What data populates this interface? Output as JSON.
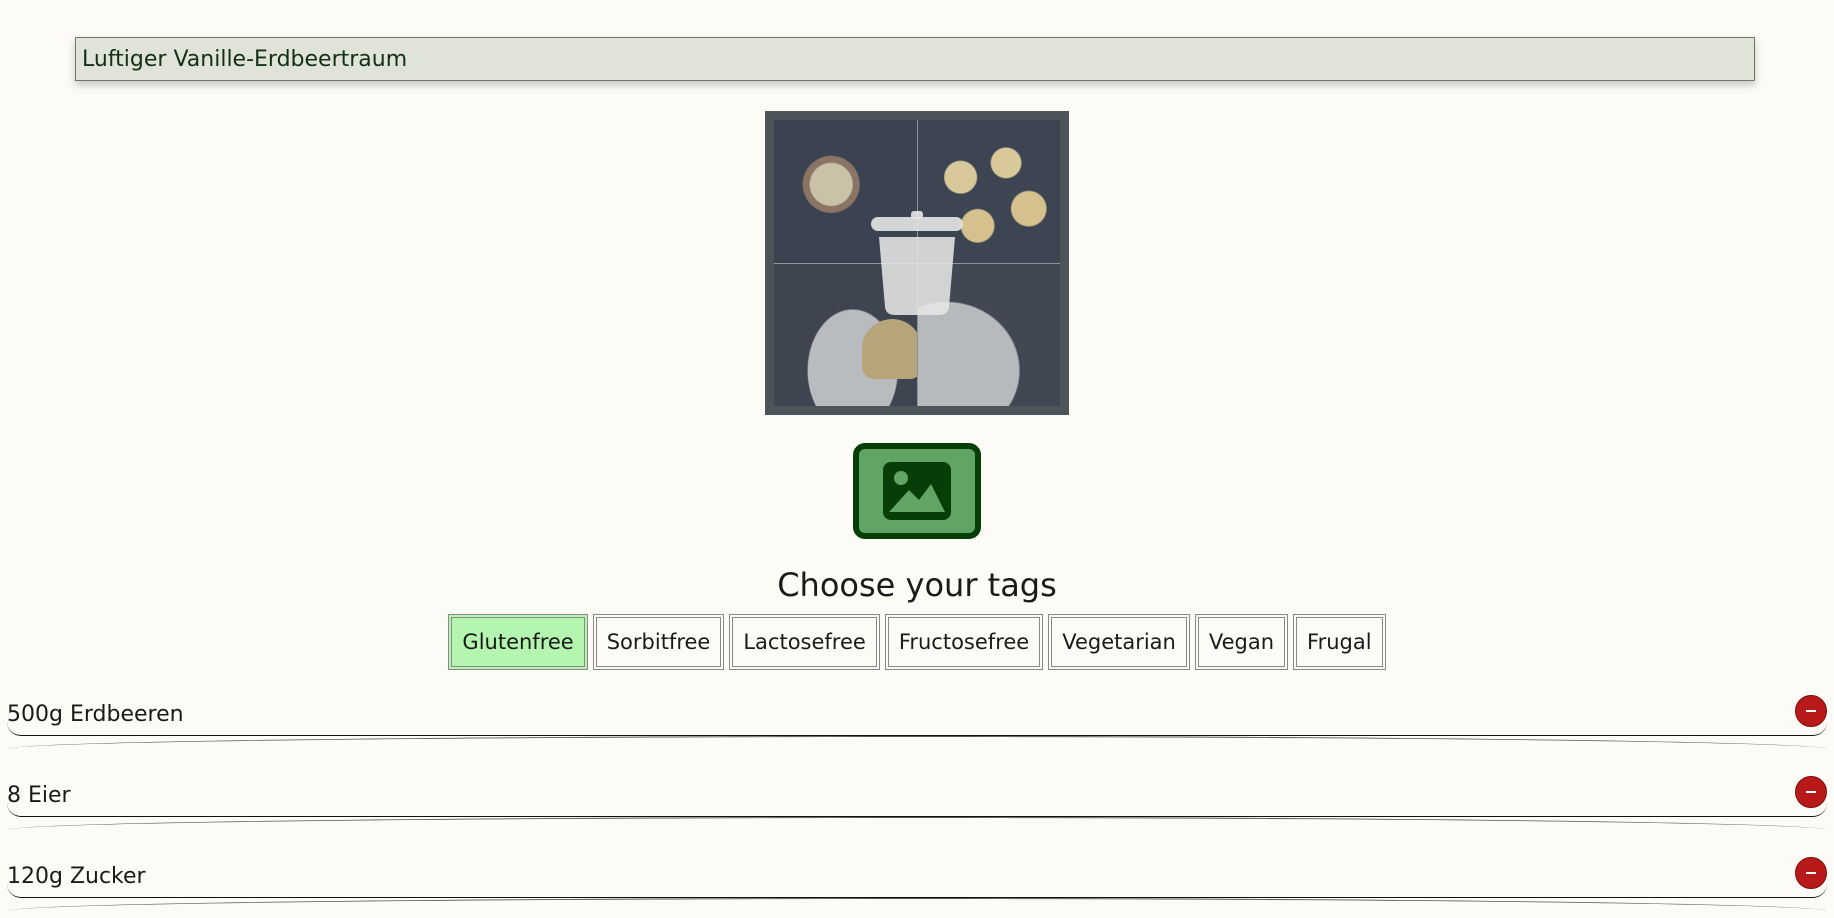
{
  "recipe": {
    "title": "Luftiger Vanille-Erdbeertraum"
  },
  "photo": {
    "overlay_icon": "trash-icon",
    "add_icon": "image-icon"
  },
  "tags": {
    "heading": "Choose your tags",
    "items": [
      {
        "label": "Glutenfree",
        "selected": true
      },
      {
        "label": "Sorbitfree",
        "selected": false
      },
      {
        "label": "Lactosefree",
        "selected": false
      },
      {
        "label": "Fructosefree",
        "selected": false
      },
      {
        "label": "Vegetarian",
        "selected": false
      },
      {
        "label": "Vegan",
        "selected": false
      },
      {
        "label": "Frugal",
        "selected": false
      }
    ]
  },
  "ingredients": [
    {
      "text": "500g Erdbeeren",
      "action_icon": "minus-icon"
    },
    {
      "text": "8 Eier",
      "action_icon": "minus-icon"
    },
    {
      "text": "120g Zucker",
      "action_icon": "minus-icon"
    }
  ],
  "colors": {
    "selected_tag": "#b4f5b0",
    "remove_button": "#b81a1a",
    "add_photo_button": "#62a464",
    "add_photo_border": "#063e08"
  }
}
